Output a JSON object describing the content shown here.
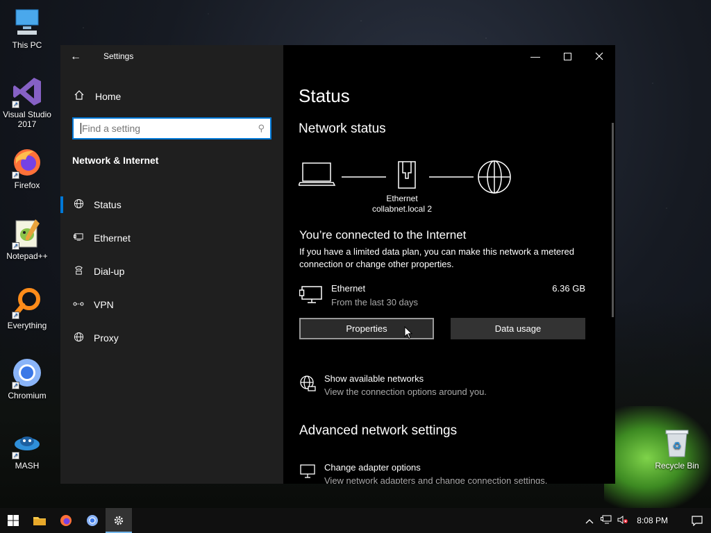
{
  "desktop": {
    "icons": [
      {
        "label": "This PC"
      },
      {
        "label": "Visual Studio 2017"
      },
      {
        "label": "Firefox"
      },
      {
        "label": "Notepad++"
      },
      {
        "label": "Everything"
      },
      {
        "label": "Chromium"
      },
      {
        "label": "MASH"
      },
      {
        "label": "Recycle Bin"
      }
    ]
  },
  "window": {
    "title": "Settings",
    "home": "Home",
    "search_placeholder": "Find a setting",
    "section": "Network & Internet",
    "nav": [
      {
        "label": "Status",
        "icon": "globe-icon",
        "active": true
      },
      {
        "label": "Ethernet",
        "icon": "ethernet-icon"
      },
      {
        "label": "Dial-up",
        "icon": "dialup-icon"
      },
      {
        "label": "VPN",
        "icon": "vpn-icon"
      },
      {
        "label": "Proxy",
        "icon": "globe-icon"
      }
    ]
  },
  "content": {
    "title": "Status",
    "network_status": "Network status",
    "adapter_name": "Ethernet",
    "adapter_network": "collabnet.local 2",
    "connected": "You’re connected to the Internet",
    "connected_desc": "If you have a limited data plan, you can make this network a metered connection or change other properties.",
    "usage": {
      "name": "Ethernet",
      "period": "From the last 30 days",
      "amount": "6.36 GB"
    },
    "buttons": {
      "properties": "Properties",
      "data_usage": "Data usage"
    },
    "show_networks": {
      "title": "Show available networks",
      "desc": "View the connection options around you."
    },
    "advanced": "Advanced network settings",
    "change_adapter": {
      "title": "Change adapter options",
      "desc": "View network adapters and change connection settings."
    }
  },
  "taskbar": {
    "clock": "8:08 PM",
    "accent": "#0078d7"
  }
}
